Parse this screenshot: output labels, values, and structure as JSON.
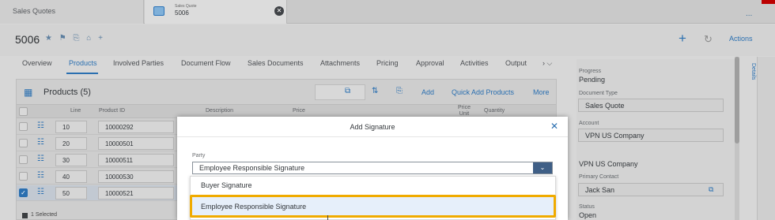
{
  "tabs": {
    "first_label": "Sales Quotes",
    "second_small": "Sales Quote",
    "second_number": "5006",
    "more_label": "..."
  },
  "header": {
    "object_id": "5006",
    "icons": "★ ⚑ ⎘ ⌂ +",
    "actions_label": "Actions"
  },
  "nav": {
    "items": [
      "Overview",
      "Products",
      "Involved Parties",
      "Document Flow",
      "Sales Documents",
      "Attachments",
      "Pricing",
      "Approval",
      "Activities",
      "Output"
    ],
    "active": "Products",
    "more": "› ⌵"
  },
  "products_table": {
    "title": "Products (5)",
    "links": [
      "Add",
      "Quick Add Products",
      "More"
    ],
    "columns": [
      "Line",
      "Product ID",
      "Description",
      "Price",
      "Price Unit",
      "Quantity"
    ],
    "rows": [
      {
        "line": "10",
        "product_id": "10000292",
        "selected": false
      },
      {
        "line": "20",
        "product_id": "10000501",
        "selected": false
      },
      {
        "line": "30",
        "product_id": "10000511",
        "selected": false
      },
      {
        "line": "40",
        "product_id": "10000530",
        "selected": false
      },
      {
        "line": "50",
        "product_id": "10000521",
        "selected": true
      }
    ],
    "selection_info": "1 Selected"
  },
  "sidebar": {
    "progress_label": "Progress",
    "progress_value": "Pending",
    "doc_type_label": "Document Type",
    "doc_type_value": "Sales Quote",
    "account_label": "Account",
    "account_value": "VPN US Company",
    "account_name": "VPN US Company",
    "primary_contact_label": "Primary Contact",
    "primary_contact_value": "Jack San",
    "status_label": "Status",
    "status_value": "Open",
    "details_label": "Details"
  },
  "dialog": {
    "title": "Add Signature",
    "party_label": "Party",
    "selected_value": "Employee Responsible Signature",
    "options": [
      "Buyer Signature",
      "Employee Responsible Signature"
    ],
    "highlighted_option": "Employee Responsible Signature"
  },
  "colors": {
    "accent": "#2a6fb0",
    "highlight_border": "#f0ab00"
  }
}
